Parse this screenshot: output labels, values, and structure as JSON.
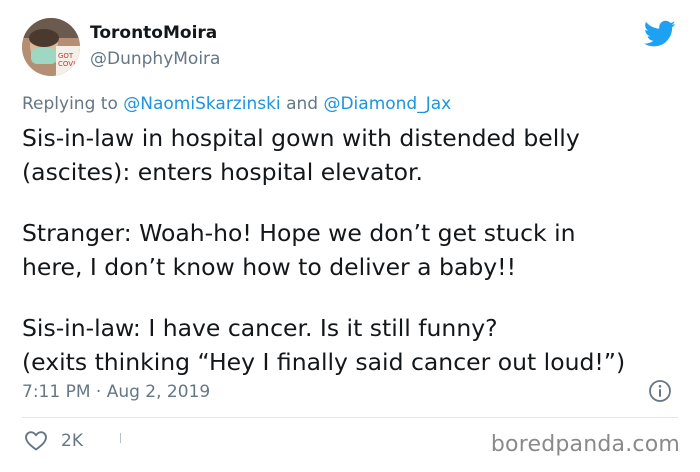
{
  "author": {
    "display_name": "TorontoMoira",
    "handle": "@DunphyMoira",
    "avatar_icon": "profile-photo"
  },
  "reply": {
    "prefix": "Replying to",
    "mention_1": "@NaomiSkarzinski",
    "conjunction": "and",
    "mention_2": "@Diamond_Jax"
  },
  "tweet": {
    "lines": [
      "Sis-in-law in hospital gown with distended belly",
      "(ascites): enters hospital elevator.",
      "Stranger: Woah-ho! Hope we don’t get stuck in",
      "here, I don’t know how to deliver a baby!!",
      "Sis-in-law: I have cancer. Is it still funny?",
      "(exits thinking “Hey I finally said cancer out loud!”)"
    ]
  },
  "meta": {
    "timestamp": "7:11 PM · Aug 2, 2019"
  },
  "actions": {
    "like_count": "2K"
  },
  "watermark": "boredpanda.com",
  "colors": {
    "twitter_blue": "#1da1f2",
    "link_blue": "#1b95e0",
    "secondary_text": "#657786",
    "primary_text": "#14171a"
  },
  "icons": [
    "twitter-bird-icon",
    "info-icon",
    "heart-icon"
  ]
}
